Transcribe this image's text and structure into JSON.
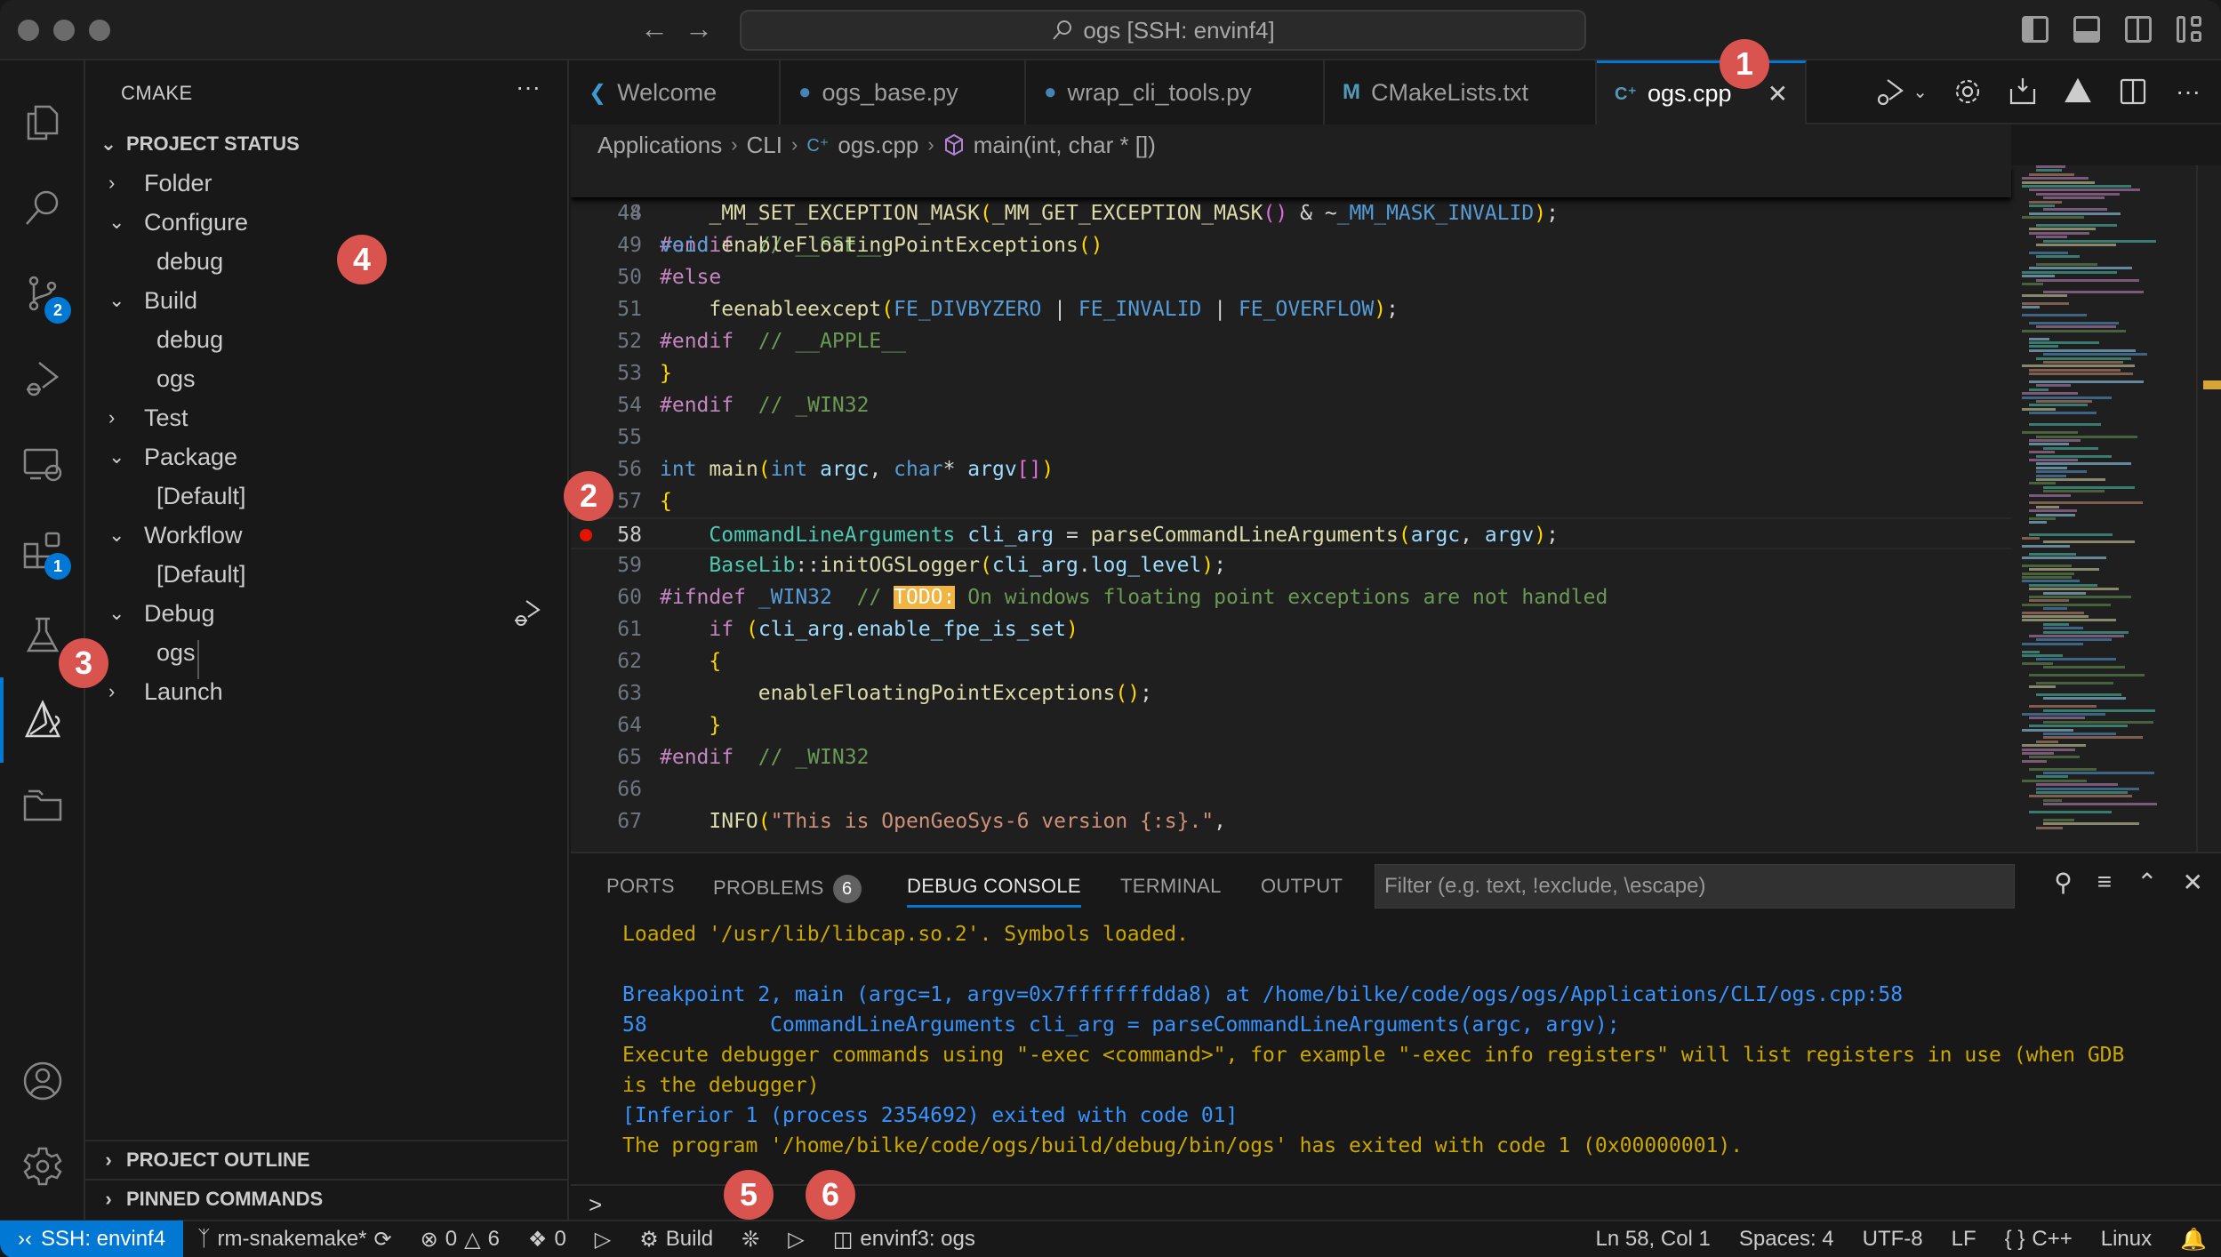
{
  "window": {
    "command_center": "ogs [SSH: envinf4]"
  },
  "activity_bar": {
    "items": [
      {
        "name": "explorer"
      },
      {
        "name": "search"
      },
      {
        "name": "source-control",
        "badge": "2"
      },
      {
        "name": "run-and-debug"
      },
      {
        "name": "remote-explorer"
      },
      {
        "name": "extensions",
        "badge": "1"
      },
      {
        "name": "testing"
      },
      {
        "name": "cmake",
        "active": true
      },
      {
        "name": "project-manager"
      }
    ],
    "bottom": [
      {
        "name": "accounts"
      },
      {
        "name": "manage"
      }
    ]
  },
  "sidebar": {
    "title": "CMAKE",
    "more": "···",
    "project_status": "PROJECT STATUS",
    "tree": [
      {
        "label": "Folder",
        "expanded": false
      },
      {
        "label": "Configure",
        "expanded": true
      },
      {
        "label": "debug"
      },
      {
        "label": "Build",
        "expanded": true
      },
      {
        "label": "debug"
      },
      {
        "label": "ogs"
      },
      {
        "label": "Test",
        "expanded": false
      },
      {
        "label": "Package",
        "expanded": true
      },
      {
        "label": "[Default]"
      },
      {
        "label": "Workflow",
        "expanded": true
      },
      {
        "label": "[Default]"
      },
      {
        "label": "Debug",
        "expanded": true
      },
      {
        "label": "ogs"
      },
      {
        "label": "Launch",
        "expanded": false
      }
    ],
    "project_outline": "PROJECT OUTLINE",
    "pinned_commands": "PINNED COMMANDS"
  },
  "tabs": [
    {
      "label": "Welcome",
      "icon": "vscode-icon"
    },
    {
      "label": "ogs_base.py",
      "icon": "python-icon"
    },
    {
      "label": "wrap_cli_tools.py",
      "icon": "python-icon"
    },
    {
      "label": "CMakeLists.txt",
      "icon": "M"
    },
    {
      "label": "ogs.cpp",
      "icon": "C++",
      "active": true
    }
  ],
  "breadcrumb": {
    "items": [
      "Applications",
      "CLI",
      "ogs.cpp",
      "main(int, char * [])"
    ]
  },
  "editor": {
    "sticky_line": {
      "n": "44",
      "code": "void enableFloatingPointExceptions()"
    },
    "current_line": "58",
    "breakpoint_line": "58",
    "lines": [
      {
        "n": "48",
        "code": "    _MM_SET_EXCEPTION_MASK(_MM_GET_EXCEPTION_MASK() & ~_MM_MASK_INVALID);"
      },
      {
        "n": "49",
        "code": "#endif  // __SSE__"
      },
      {
        "n": "50",
        "code": "#else"
      },
      {
        "n": "51",
        "code": "    feenableexcept(FE_DIVBYZERO | FE_INVALID | FE_OVERFLOW);"
      },
      {
        "n": "52",
        "code": "#endif  // __APPLE__"
      },
      {
        "n": "53",
        "code": "}"
      },
      {
        "n": "54",
        "code": "#endif  // _WIN32"
      },
      {
        "n": "55",
        "code": ""
      },
      {
        "n": "56",
        "code": "int main(int argc, char* argv[])"
      },
      {
        "n": "57",
        "code": "{"
      },
      {
        "n": "58",
        "code": "    CommandLineArguments cli_arg = parseCommandLineArguments(argc, argv);"
      },
      {
        "n": "59",
        "code": "    BaseLib::initOGSLogger(cli_arg.log_level);"
      },
      {
        "n": "60",
        "code": "#ifndef _WIN32  // TODO: On windows floating point exceptions are not handled"
      },
      {
        "n": "61",
        "code": "    if (cli_arg.enable_fpe_is_set)"
      },
      {
        "n": "62",
        "code": "    {"
      },
      {
        "n": "63",
        "code": "        enableFloatingPointExceptions();"
      },
      {
        "n": "64",
        "code": "    }"
      },
      {
        "n": "65",
        "code": "#endif  // _WIN32"
      },
      {
        "n": "66",
        "code": ""
      },
      {
        "n": "67",
        "code": "    INFO(\"This is OpenGeoSys-6 version {:s}.\","
      }
    ]
  },
  "panel": {
    "tabs": [
      {
        "label": "PORTS"
      },
      {
        "label": "PROBLEMS",
        "badge": "6"
      },
      {
        "label": "DEBUG CONSOLE",
        "active": true
      },
      {
        "label": "TERMINAL"
      },
      {
        "label": "OUTPUT"
      }
    ],
    "filter_placeholder": "Filter (e.g. text, !exclude, \\escape)",
    "console_lines": [
      {
        "text": "Loaded '/usr/lib/libcap.so.2'. Symbols loaded.",
        "color": "yellow"
      },
      {
        "text": "",
        "color": "yellow"
      },
      {
        "text": "Breakpoint 2, main (argc=1, argv=0x7fffffffdda8) at /home/bilke/code/ogs/ogs/Applications/CLI/ogs.cpp:58",
        "color": "blue"
      },
      {
        "text": "58          CommandLineArguments cli_arg = parseCommandLineArguments(argc, argv);",
        "color": "blue"
      },
      {
        "text": "Execute debugger commands using \"-exec <command>\", for example \"-exec info registers\" will list registers in use (when GDB",
        "color": "yellow"
      },
      {
        "text": "is the debugger)",
        "color": "yellow"
      },
      {
        "text": "[Inferior 1 (process 2354692) exited with code 01]",
        "color": "blue"
      },
      {
        "text": "The program '/home/bilke/code/ogs/build/debug/bin/ogs' has exited with code 1 (0x00000001).",
        "color": "yellow"
      }
    ],
    "prompt": ">"
  },
  "statusbar": {
    "remote": "SSH: envinf4",
    "branch": "rm-snakemake*",
    "errors": "0",
    "warnings": "6",
    "ports": "0",
    "build": "Build",
    "launch_target": "envinf3: ogs",
    "position": "Ln 58, Col 1",
    "spaces": "Spaces: 4",
    "encoding": "UTF-8",
    "eol": "LF",
    "language": "C++",
    "platform": "Linux"
  },
  "annotations": [
    "1",
    "2",
    "3",
    "4",
    "5",
    "6"
  ],
  "colors": {
    "accent": "#0078d4",
    "breakpoint": "#e51400",
    "annotation": "#d9534f",
    "todo_highlight": "#f2b441"
  }
}
